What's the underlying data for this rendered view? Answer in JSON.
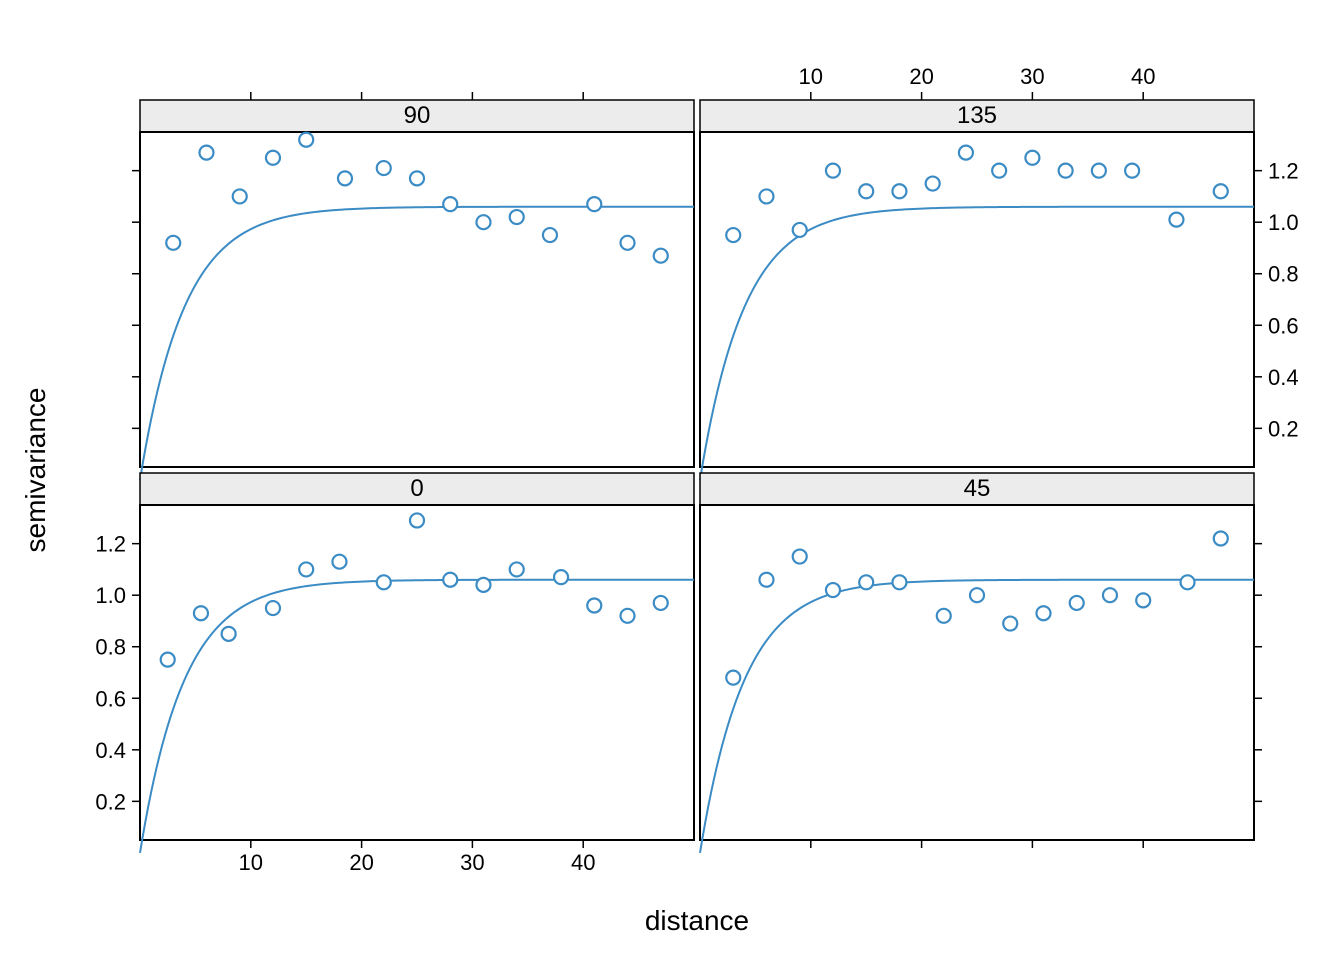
{
  "chart_data": {
    "type": "scatter",
    "xlabel": "distance",
    "ylabel": "semivariance",
    "xlim": [
      0,
      50
    ],
    "ylim": [
      0.05,
      1.35
    ],
    "x_ticks": [
      10,
      20,
      30,
      40
    ],
    "y_ticks": [
      0.2,
      0.4,
      0.6,
      0.8,
      1.0,
      1.2
    ],
    "model": {
      "sill": 1.06,
      "range": 4.0
    },
    "panels": [
      {
        "label": "90",
        "row": 0,
        "col": 0,
        "x_axis": "top_outside_none",
        "y_axis": "left_outside_none",
        "points": [
          {
            "x": 3,
            "y": 0.92
          },
          {
            "x": 6,
            "y": 1.27
          },
          {
            "x": 9,
            "y": 1.1
          },
          {
            "x": 12,
            "y": 1.25
          },
          {
            "x": 15,
            "y": 1.32
          },
          {
            "x": 18.5,
            "y": 1.17
          },
          {
            "x": 22,
            "y": 1.21
          },
          {
            "x": 25,
            "y": 1.17
          },
          {
            "x": 28,
            "y": 1.07
          },
          {
            "x": 31,
            "y": 1.0
          },
          {
            "x": 34,
            "y": 1.02
          },
          {
            "x": 37,
            "y": 0.95
          },
          {
            "x": 41,
            "y": 1.07
          },
          {
            "x": 44,
            "y": 0.92
          },
          {
            "x": 47,
            "y": 0.87
          }
        ]
      },
      {
        "label": "135",
        "row": 0,
        "col": 1,
        "x_axis": "top_outside",
        "y_axis": "right_outside",
        "points": [
          {
            "x": 3,
            "y": 0.95
          },
          {
            "x": 6,
            "y": 1.1
          },
          {
            "x": 9,
            "y": 0.97
          },
          {
            "x": 12,
            "y": 1.2
          },
          {
            "x": 15,
            "y": 1.12
          },
          {
            "x": 18,
            "y": 1.12
          },
          {
            "x": 21,
            "y": 1.15
          },
          {
            "x": 24,
            "y": 1.27
          },
          {
            "x": 27,
            "y": 1.2
          },
          {
            "x": 30,
            "y": 1.25
          },
          {
            "x": 33,
            "y": 1.2
          },
          {
            "x": 36,
            "y": 1.2
          },
          {
            "x": 39,
            "y": 1.2
          },
          {
            "x": 43,
            "y": 1.01
          },
          {
            "x": 47,
            "y": 1.12
          }
        ]
      },
      {
        "label": "0",
        "row": 1,
        "col": 0,
        "x_axis": "bottom_outside",
        "y_axis": "left_outside",
        "points": [
          {
            "x": 2.5,
            "y": 0.75
          },
          {
            "x": 5.5,
            "y": 0.93
          },
          {
            "x": 8,
            "y": 0.85
          },
          {
            "x": 12,
            "y": 0.95
          },
          {
            "x": 15,
            "y": 1.1
          },
          {
            "x": 18,
            "y": 1.13
          },
          {
            "x": 22,
            "y": 1.05
          },
          {
            "x": 25,
            "y": 1.29
          },
          {
            "x": 28,
            "y": 1.06
          },
          {
            "x": 31,
            "y": 1.04
          },
          {
            "x": 34,
            "y": 1.1
          },
          {
            "x": 38,
            "y": 1.07
          },
          {
            "x": 41,
            "y": 0.96
          },
          {
            "x": 44,
            "y": 0.92
          },
          {
            "x": 47,
            "y": 0.97
          }
        ]
      },
      {
        "label": "45",
        "row": 1,
        "col": 1,
        "x_axis": "bottom_outside_none",
        "y_axis": "right_outside_none",
        "points": [
          {
            "x": 3,
            "y": 0.68
          },
          {
            "x": 6,
            "y": 1.06
          },
          {
            "x": 9,
            "y": 1.15
          },
          {
            "x": 12,
            "y": 1.02
          },
          {
            "x": 15,
            "y": 1.05
          },
          {
            "x": 18,
            "y": 1.05
          },
          {
            "x": 22,
            "y": 0.92
          },
          {
            "x": 25,
            "y": 1.0
          },
          {
            "x": 28,
            "y": 0.89
          },
          {
            "x": 31,
            "y": 0.93
          },
          {
            "x": 34,
            "y": 0.97
          },
          {
            "x": 37,
            "y": 1.0
          },
          {
            "x": 40,
            "y": 0.98
          },
          {
            "x": 44,
            "y": 1.05
          },
          {
            "x": 47,
            "y": 1.22
          }
        ]
      }
    ],
    "colors": {
      "point_stroke": "#3b8bc4",
      "line_stroke": "#3b8bc4",
      "strip_bg": "#ececec",
      "frame": "#000000",
      "tick": "#000000",
      "text": "#000000"
    }
  }
}
